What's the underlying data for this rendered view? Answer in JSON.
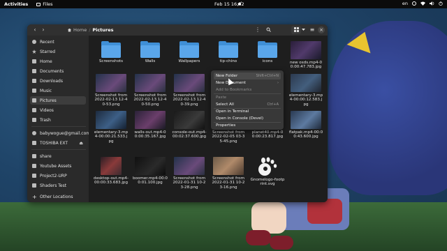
{
  "topbar": {
    "activities": "Activities",
    "app_name": "Files",
    "clock": "Feb 15  16:12",
    "lang": "en"
  },
  "window": {
    "breadcrumb": {
      "home": "Home",
      "current": "Pictures"
    },
    "sidebar": [
      {
        "label": "Recent"
      },
      {
        "label": "Starred"
      },
      {
        "label": "Home"
      },
      {
        "label": "Documents"
      },
      {
        "label": "Downloads"
      },
      {
        "label": "Music"
      },
      {
        "label": "Pictures"
      },
      {
        "label": "Videos"
      },
      {
        "label": "Trash"
      },
      {
        "label": "babywogue@gmail.com"
      },
      {
        "label": "TOSHIBA EXT"
      },
      {
        "label": "share"
      },
      {
        "label": "Youtube Assets"
      },
      {
        "label": "Project2-URP"
      },
      {
        "label": "Shaders Test"
      },
      {
        "label": "Other Locations"
      }
    ],
    "files": [
      {
        "label": "Screenshots"
      },
      {
        "label": "Walls"
      },
      {
        "label": "Wallpapers"
      },
      {
        "label": "tip-chino"
      },
      {
        "label": "icons"
      },
      {
        "label": "new osds.mp4-00:00:47.783.jpg"
      },
      {
        "label": "Screenshot from 2022-02-13 12-40-53.png"
      },
      {
        "label": "Screenshot from 2022-02-13 12-40-50.png"
      },
      {
        "label": "Screenshot from 2022-02-13 12-40-39.png"
      },
      {
        "label": "elementary-3.mp4-00:00:12.583.jpg"
      },
      {
        "label": "elementary-3.mp4-00:00:21.533.jpg"
      },
      {
        "label": "walls-out.mp4-00:00:35.167.jpg"
      },
      {
        "label": "console-out.mp4-00:02:37.600.jpg"
      },
      {
        "label": "Screenshot from 2022-02-05 03-35-45.png"
      },
      {
        "label": "planet40.mp4-00:00:23.817.jpg"
      },
      {
        "label": "flatpak.mp4-00:00:43.600.jpg"
      },
      {
        "label": "desktop-out.mp4-00:00:33.683.jpg"
      },
      {
        "label": "boomer.mp4-00:00:01.100.jpg"
      },
      {
        "label": "Screenshot from 2022-01-31 10-23-28.png"
      },
      {
        "label": "Screenshot from 2022-01-31 10-23-16.png"
      },
      {
        "label": "Gnomelogo-footprint.svg"
      }
    ],
    "context_menu": [
      {
        "label": "New Folder",
        "accel": "Shift+Ctrl+N"
      },
      {
        "label": "New Document",
        "accel": "›"
      },
      {
        "label": "Add to Bookmarks",
        "accel": ""
      },
      {
        "label": "Paste",
        "accel": ""
      },
      {
        "label": "Select All",
        "accel": "Ctrl+A"
      },
      {
        "label": "Open in Terminal",
        "accel": ""
      },
      {
        "label": "Open in Console (Devel)",
        "accel": ""
      },
      {
        "label": "Properties",
        "accel": ""
      }
    ]
  }
}
